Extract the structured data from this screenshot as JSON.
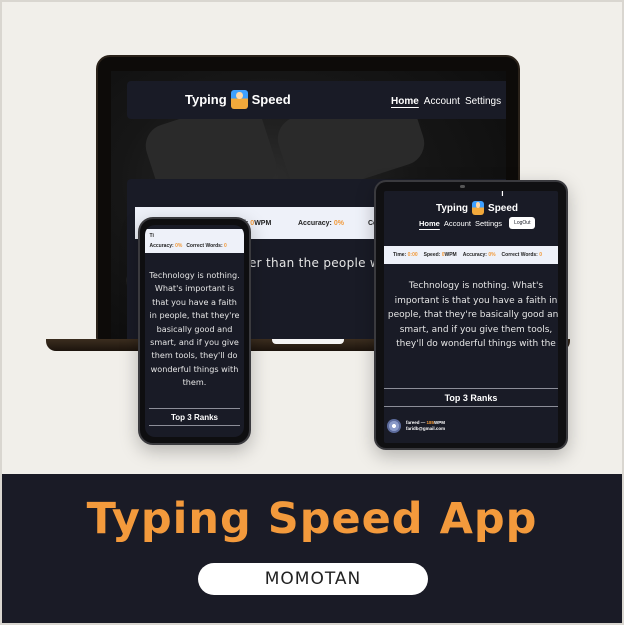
{
  "app": {
    "brand_left": "Typing",
    "brand_right": "Speed",
    "brand_icon": "typing-person-icon"
  },
  "nav": {
    "home": "Home",
    "account": "Account",
    "settings": "Settings",
    "logout": "LogOut"
  },
  "stats": {
    "time_label": "Time:",
    "time_value": "0:00",
    "speed_label": "Speed:",
    "speed_value": "0",
    "speed_unit": "WPM",
    "accuracy_label": "Accuracy:",
    "accuracy_value": "0%",
    "correct_words_label": "Correct Words:",
    "correct_words_value": "0"
  },
  "laptop": {
    "panel_fragment": "Ty",
    "stats_fragment": "Co",
    "text_fragment": "er than the people wh"
  },
  "phone": {
    "top_fragment": "Ti",
    "text": "Technology is nothing. What's important is that you have a faith in people, that they're basically good and smart, and if you give them tools, they'll do wonderful things with them."
  },
  "tablet": {
    "title_fragment": "T",
    "text": "Technology is nothing. What's important is that you have a faith in people, that they're basically good and smart, and if you give them tools, they'll do wonderful things with the"
  },
  "ranks": {
    "title": "Top 3 Ranks",
    "entries": [
      {
        "name": "fareed",
        "separator": " — ",
        "wpm_value": "185",
        "wpm_unit": "WPM",
        "email": "faridb@gmail.com"
      }
    ]
  },
  "footer": {
    "title": "Typing Speed App",
    "author": "MOMOTAN"
  },
  "colors": {
    "accent": "#f39a3c",
    "dark_ui": "#191b26",
    "footer_bg": "#1a1b26",
    "page_bg": "#f1efea"
  }
}
